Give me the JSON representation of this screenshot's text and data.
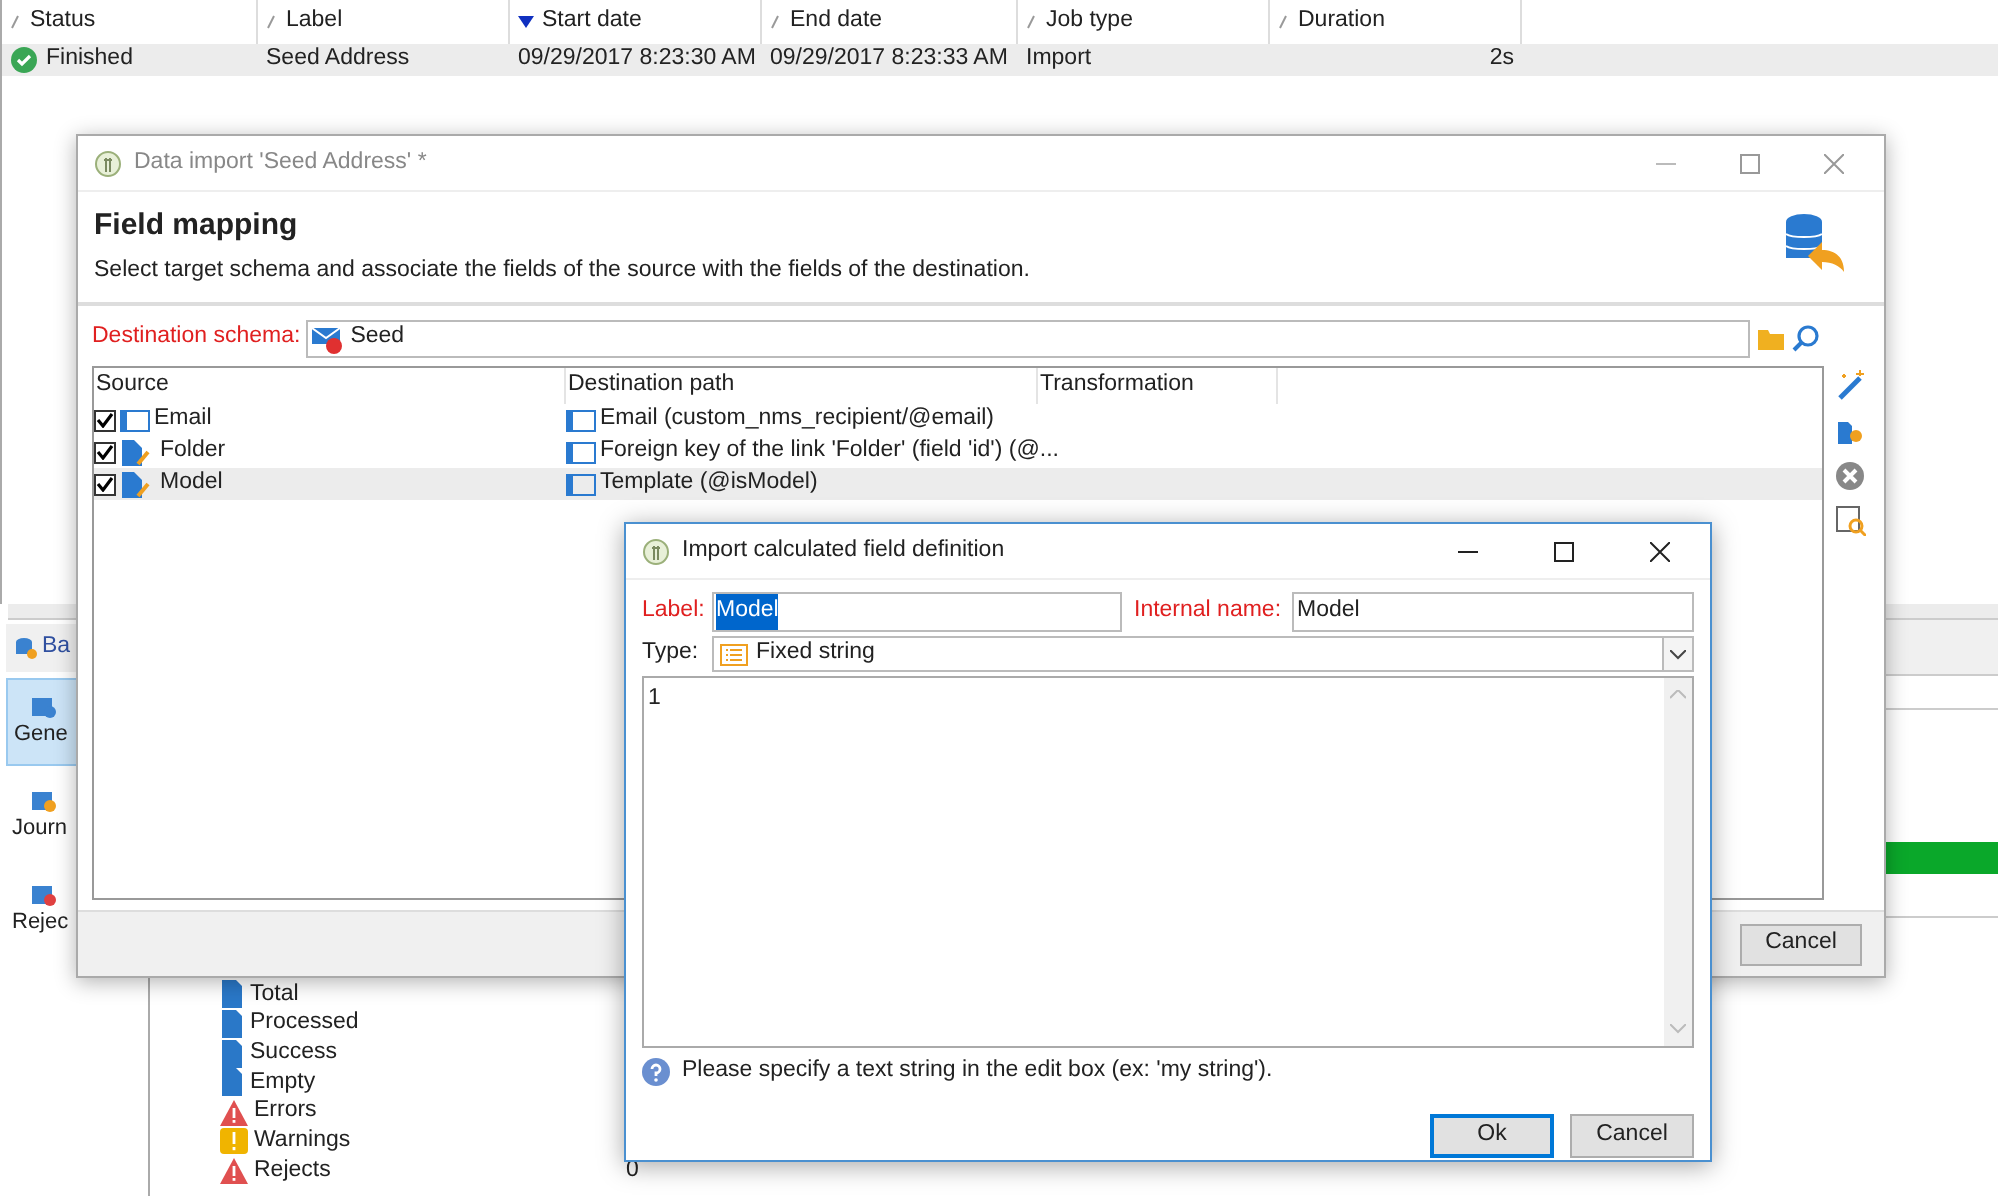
{
  "jobs_table": {
    "columns": [
      {
        "label": "Status",
        "sorted": false
      },
      {
        "label": "Label",
        "sorted": false
      },
      {
        "label": "Start date",
        "sorted": true
      },
      {
        "label": "End date",
        "sorted": false
      },
      {
        "label": "Job type",
        "sorted": false
      },
      {
        "label": "Duration",
        "sorted": false
      }
    ],
    "rows": [
      {
        "status": "Finished",
        "label": "Seed Address",
        "start": "09/29/2017 8:23:30 AM",
        "end": "09/29/2017 8:23:33 AM",
        "job_type": "Import",
        "duration": "2s",
        "selected": true
      }
    ]
  },
  "side_tabs": [
    {
      "label": "Ba",
      "kind": "header"
    },
    {
      "label": "Gene",
      "kind": "tab",
      "selected": true
    },
    {
      "label": "Journ",
      "kind": "tab",
      "selected": false
    },
    {
      "label": "Rejec",
      "kind": "tab",
      "selected": false
    }
  ],
  "progress": {
    "level": 1
  },
  "counters": [
    {
      "label": "Total",
      "kind": "file"
    },
    {
      "label": "Processed",
      "kind": "file"
    },
    {
      "label": "Success",
      "kind": "file"
    },
    {
      "label": "Empty",
      "kind": "file"
    },
    {
      "label": "Errors",
      "kind": "error"
    },
    {
      "label": "Warnings",
      "kind": "warning"
    },
    {
      "label": "Rejects",
      "kind": "error",
      "value": "0"
    }
  ],
  "import_dialog": {
    "title": "Data import 'Seed Address' *",
    "heading": "Field mapping",
    "description": "Select target schema and associate the fields of the source with the fields of the destination.",
    "schema_label": "Destination schema:",
    "schema_value": "Seed",
    "columns": [
      "Source",
      "Destination path",
      "Transformation"
    ],
    "rows": [
      {
        "source": "Email",
        "kind": "field",
        "checked": true,
        "destination": "Email (custom_nms_recipient/@email)",
        "selected": false
      },
      {
        "source": "Folder",
        "kind": "calculated",
        "checked": true,
        "destination": "Foreign key of the link 'Folder' (field 'id') (@...",
        "selected": false
      },
      {
        "source": "Model",
        "kind": "calculated",
        "checked": true,
        "destination": "Template (@isModel)",
        "selected": true
      }
    ],
    "buttons": [
      "Cancel"
    ]
  },
  "calc_dialog": {
    "title": "Import calculated field definition",
    "label_caption": "Label:",
    "label_value": "Model",
    "internal_caption": "Internal name:",
    "internal_value": "Model",
    "type_caption": "Type:",
    "type_value": "Fixed string",
    "expression": "1",
    "help": "Please specify a text string in the edit box (ex: 'my string').",
    "buttons": [
      {
        "label": "Ok",
        "default": true
      },
      {
        "label": "Cancel",
        "default": false
      }
    ]
  }
}
